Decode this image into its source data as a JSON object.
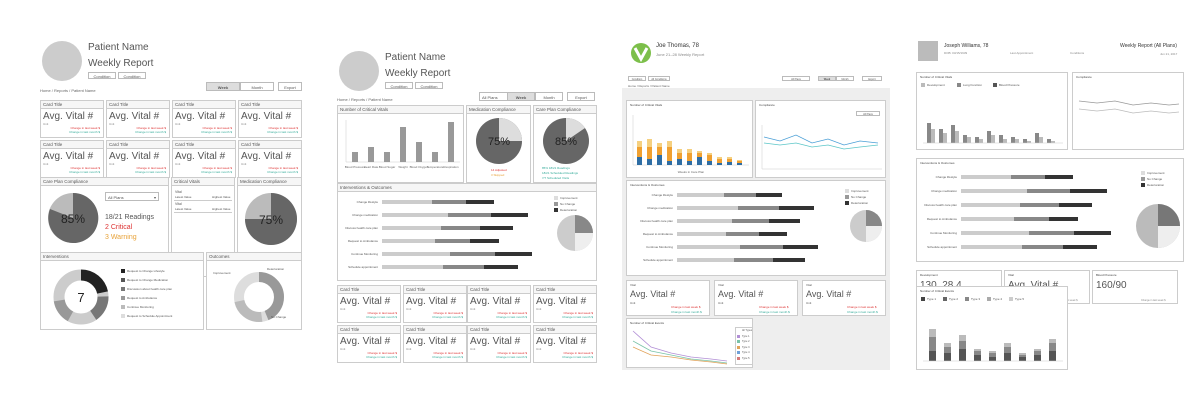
{
  "p1": {
    "patient_name": "Patient Name",
    "report_title": "Weekly Report",
    "condition1": "Condition",
    "condition2": "Condition",
    "crumb": "Home / Reports / Patient Name",
    "week": "Week",
    "month": "Month",
    "export": "Export",
    "card_title": "Card Title",
    "avg": "Avg. Vital #",
    "unit": "Unit",
    "chg_red": "Change in last week $",
    "chg_green": "Change in last month $",
    "careplan_title": "Care Plan Compliance",
    "careplan_pct": "85%",
    "all_plans": "All Plans",
    "readings": "18/21 Readings",
    "critical": "2 Critical",
    "warning": "3 Warning",
    "critical_vitals_title": "Critical Vitals",
    "vital": "Vital",
    "latest_value": "Latest Value",
    "highest_value": "Highest Value",
    "med_title": "Medication Compliance",
    "med_pct": "75%",
    "interventions_title": "Interventions",
    "interventions_count": "7",
    "interventions_legend": [
      "Request to Change Lifestyle",
      "Request to Change Medication",
      "Discussion about health care plan",
      "Request to Ambulance",
      "Continue Monitoring",
      "Request to Schedule Appointment"
    ],
    "outcomes_title": "Outcomes",
    "outcomes_labels": [
      "Improvement",
      "Deterioration",
      "No Change"
    ]
  },
  "p2": {
    "patient_name": "Patient Name",
    "report_title": "Weekly Report",
    "condition1": "Condition",
    "condition2": "Condition",
    "crumb": "Home / Reports / Patient Name",
    "all_plans": "All Plans",
    "week": "Week",
    "month": "Month",
    "export": "Export",
    "critical_vitals_title": "Number of Critical Vitals",
    "bar_labels": [
      "Blood Pressure",
      "Heart Rate",
      "Blood Sugar",
      "Weight",
      "Blood Oxygen",
      "Temperature",
      "Respiration"
    ],
    "med_title": "Medication Compliance",
    "med_pct": "75%",
    "med_red": "14 Adjusted",
    "med_orange": "3 Skipped",
    "careplan_title": "Care Plan Compliance",
    "careplan_pct": "85%",
    "careplan_g1": "85% 18/21 Readings",
    "careplan_g2": "18/21 Scheduled Readings",
    "careplan_g3": "7/7 Scheduled Visits",
    "io_title": "Interventions & Outcomes",
    "io_rows": [
      "Change lifestyle",
      "Change medication",
      "Discuss health care plan",
      "Request to Ambulance",
      "Continue Monitoring",
      "Schedule appointment"
    ],
    "io_legend": [
      "Improvement",
      "No Change",
      "Deterioration"
    ],
    "card_title": "Card Title",
    "avg": "Avg. Vital #",
    "unit": "Unit",
    "chg_red": "Change in last week $",
    "chg_green": "Change in last month $"
  },
  "p3": {
    "name": "Joe Thomas, 78",
    "sub": "June 21–28 Weekly Report",
    "btn1": "Condition",
    "btn2": "All Conditions",
    "crumb": "Home / Reports / Patient Name",
    "plans": "All Plans",
    "week": "Week",
    "month": "Month",
    "export": "Export",
    "crit_title": "Number of Critical Vitals",
    "compliance_title": "Compliance",
    "all_plans_small": "All Plans",
    "axis_days": "Weeks in Care Plan",
    "io_title": "Interventions & Outcomes",
    "io_rows": [
      "Change lifestyle",
      "Change medication",
      "Discuss health care plan",
      "Request to Ambulance",
      "Continue Monitoring",
      "Schedule appointment"
    ],
    "io_legend": [
      "Improvement",
      "No Change",
      "Deterioration"
    ],
    "vital": "Vital",
    "avg": "Avg. Vital #",
    "unit": "Unit",
    "chg_red": "Change in last week $",
    "chg_green": "Change in last month $",
    "line_title": "Number of Critical Events",
    "types": [
      "All Types",
      "Type 1",
      "Type 2",
      "Type 3",
      "Type 4",
      "Type 5"
    ]
  },
  "p4": {
    "name": "Joseph Williams, 78",
    "weekly": "Weekly Report (All Plans)",
    "date": "Jun 21, 2017",
    "meta1": "DOB: 03/15/1939",
    "meta2": "Last Appointment",
    "meta3": "Conditions",
    "crit_title": "Number of Critical Vitals",
    "crit_legend": [
      "Development",
      "Lung Function",
      "Blood Pressure"
    ],
    "compliance_title": "Compliance",
    "io_title": "Interventions & Outcomes",
    "io_rows": [
      "Change lifestyle",
      "Change medication",
      "Discuss health care plan",
      "Request to Ambulance",
      "Continue Monitoring",
      "Schedule appointment"
    ],
    "io_legend": [
      "Improvement",
      "No Change",
      "Deterioration"
    ],
    "dev_title": "Development",
    "dev_value": "130, 28.4",
    "vital_title": "Vital",
    "vital_value": "Avg. Vital #",
    "bp_title": "Blood Pressure",
    "bp_value": "160/90",
    "chg": "Change in last week $",
    "events_title": "Number of Critical Events",
    "types": [
      "Type 1",
      "Type 2",
      "Type 3",
      "Type 4",
      "Type 5"
    ]
  }
}
